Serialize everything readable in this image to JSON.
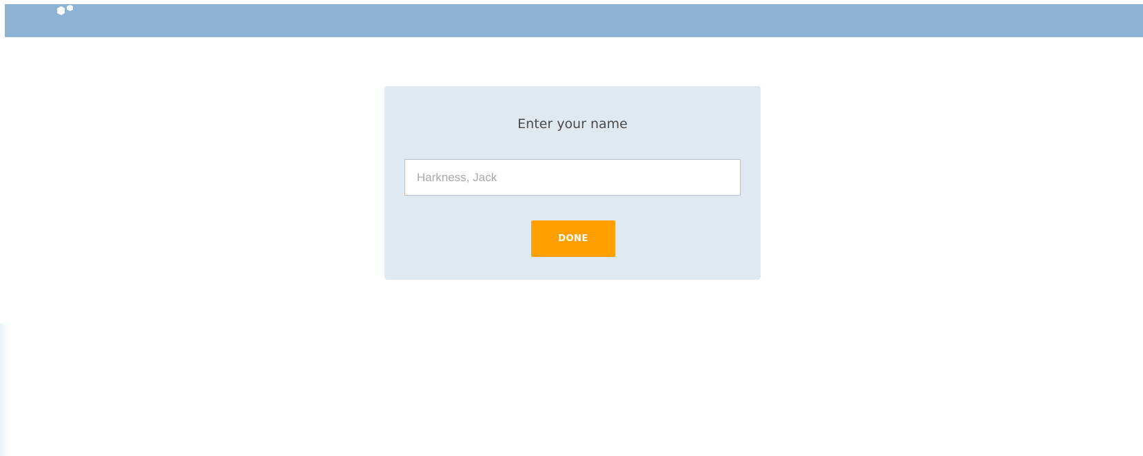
{
  "header": {
    "background_color": "#8cb3d4",
    "logo_icon": "hexagon-logo-icon"
  },
  "dialog": {
    "title": "Enter your name",
    "name_input": {
      "value": "",
      "placeholder": "Harkness, Jack"
    },
    "done_label": "DONE",
    "background_color": "#dfe9f2",
    "button_color": "#ff9f00"
  }
}
